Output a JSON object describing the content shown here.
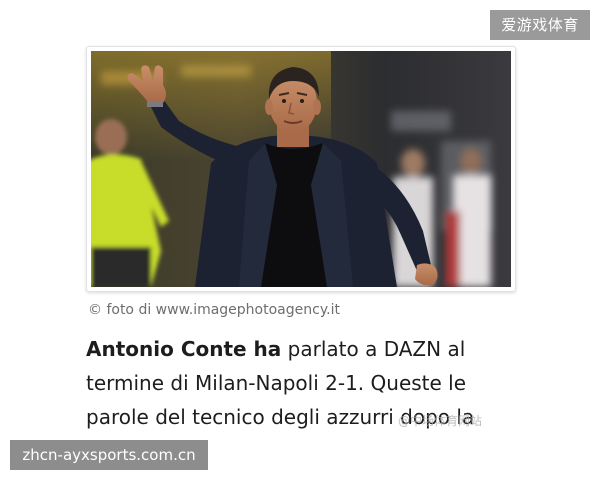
{
  "badges": {
    "top_right": "爱游戏体育",
    "bottom_left": "zhcn-ayxsports.com.cn"
  },
  "photo": {
    "credit": "© foto di www.imagephotoagency.it"
  },
  "article": {
    "bold_lead": "Antonio Conte ha",
    "line1_rest": " parlato a DAZN al",
    "line2": "termine di Milan-Napoli 2-1. Queste le",
    "line3": "parole del tecnico degli azzurri dopo la"
  },
  "watermark": "@中场体育网站",
  "colors": {
    "badge_top": "#9a9a9a",
    "badge_bottom": "#8d8d8d",
    "credit_text": "#6e6e6e",
    "body_text": "#1d1d1d"
  }
}
